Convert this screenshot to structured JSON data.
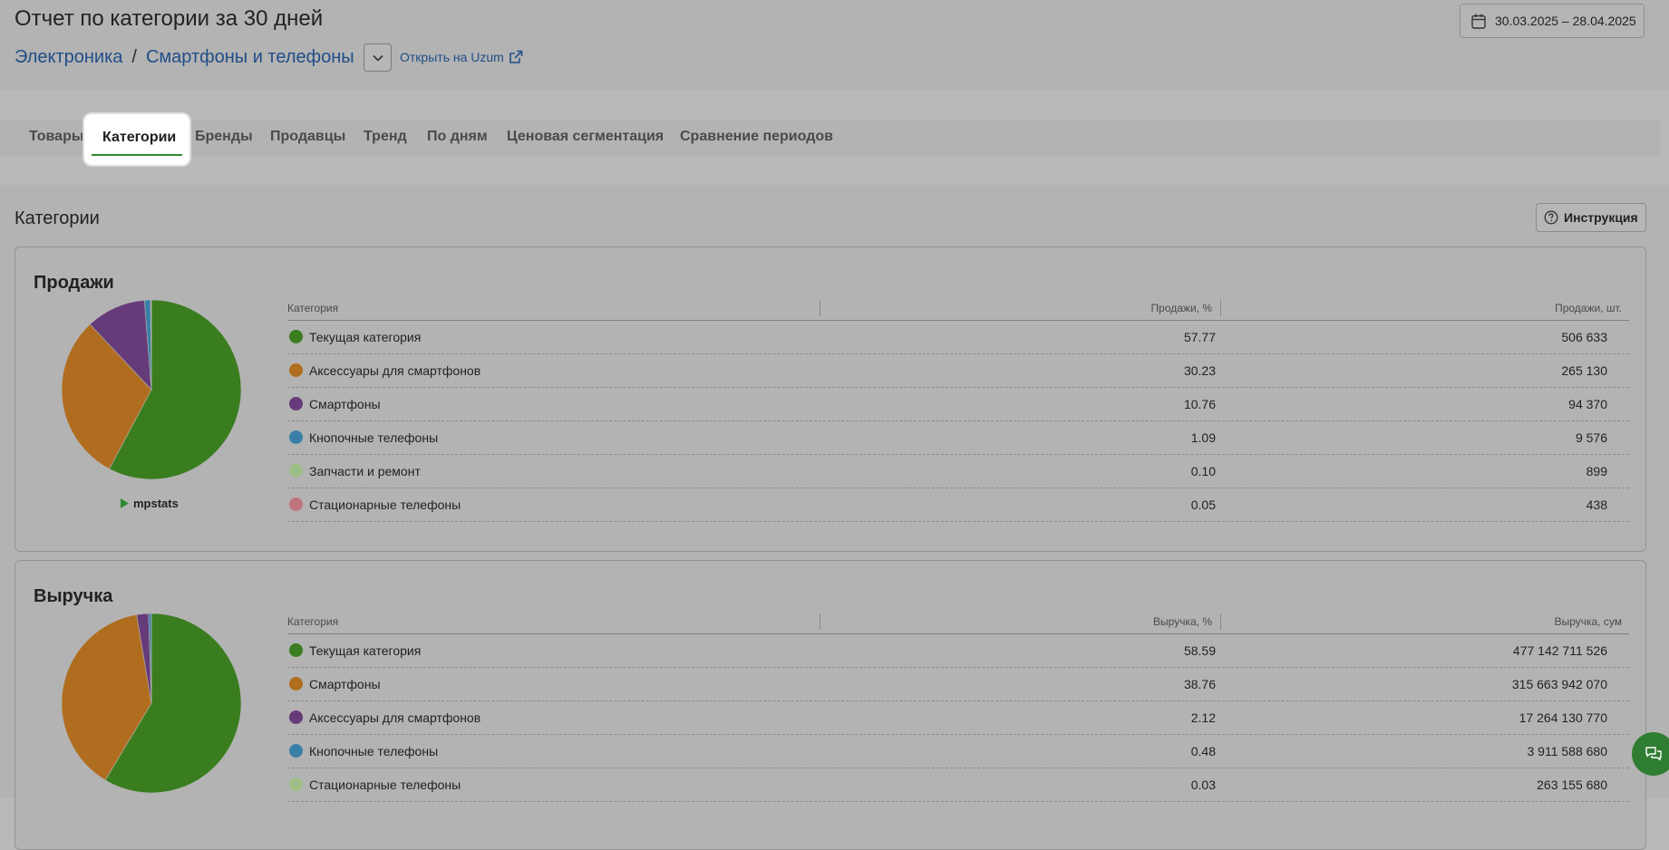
{
  "header": {
    "title": "Отчет по категории за 30 дней",
    "date_range": "30.03.2025 – 28.04.2025",
    "breadcrumb": [
      "Электроника",
      "Смартфоны и телефоны"
    ],
    "breadcrumb_sep": "/",
    "open_link": "Открыть на Uzum"
  },
  "tabs": [
    {
      "label": "Товары",
      "active": false
    },
    {
      "label": "Категории",
      "active": true
    },
    {
      "label": "Бренды",
      "active": false
    },
    {
      "label": "Продавцы",
      "active": false
    },
    {
      "label": "Тренд",
      "active": false
    },
    {
      "label": "По дням",
      "active": false
    },
    {
      "label": "Ценовая сегментация",
      "active": false
    },
    {
      "label": "Сравнение периодов",
      "active": false
    }
  ],
  "section": {
    "title": "Категории",
    "instruction_label": "Инструкция"
  },
  "brand": "mpstats",
  "colors": {
    "green": "#3a7d1f",
    "orange": "#b06d1f",
    "purple": "#663b7a",
    "blue": "#3a7fa6",
    "lightgreen": "#9dbf87",
    "pink": "#c0757d",
    "accent": "#2f8a2f",
    "link": "#1f4e88"
  },
  "sales": {
    "title": "Продажи",
    "headers": [
      "Категория",
      "Продажи, %",
      "Продажи, шт."
    ],
    "rows": [
      {
        "name": "Текущая категория",
        "pct": "57.77",
        "value": "506 633",
        "color": "#3a7d1f"
      },
      {
        "name": "Аксессуары для смартфонов",
        "pct": "30.23",
        "value": "265 130",
        "color": "#b06d1f"
      },
      {
        "name": "Смартфоны",
        "pct": "10.76",
        "value": "94 370",
        "color": "#663b7a"
      },
      {
        "name": "Кнопочные телефоны",
        "pct": "1.09",
        "value": "9 576",
        "color": "#3a7fa6"
      },
      {
        "name": "Запчасти и ремонт",
        "pct": "0.10",
        "value": "899",
        "color": "#9dbf87"
      },
      {
        "name": "Стационарные телефоны",
        "pct": "0.05",
        "value": "438",
        "color": "#c0757d"
      }
    ]
  },
  "revenue": {
    "title": "Выручка",
    "headers": [
      "Категория",
      "Выручка, %",
      "Выручка, сум"
    ],
    "rows": [
      {
        "name": "Текущая категория",
        "pct": "58.59",
        "value": "477 142 711 526",
        "color": "#3a7d1f"
      },
      {
        "name": "Смартфоны",
        "pct": "38.76",
        "value": "315 663 942 070",
        "color": "#b06d1f"
      },
      {
        "name": "Аксессуары для смартфонов",
        "pct": "2.12",
        "value": "17 264 130 770",
        "color": "#663b7a"
      },
      {
        "name": "Кнопочные телефоны",
        "pct": "0.48",
        "value": "3 911 588 680",
        "color": "#3a7fa6"
      },
      {
        "name": "Стационарные телефоны",
        "pct": "0.03",
        "value": "263 155 680",
        "color": "#9dbf87"
      }
    ]
  }
}
